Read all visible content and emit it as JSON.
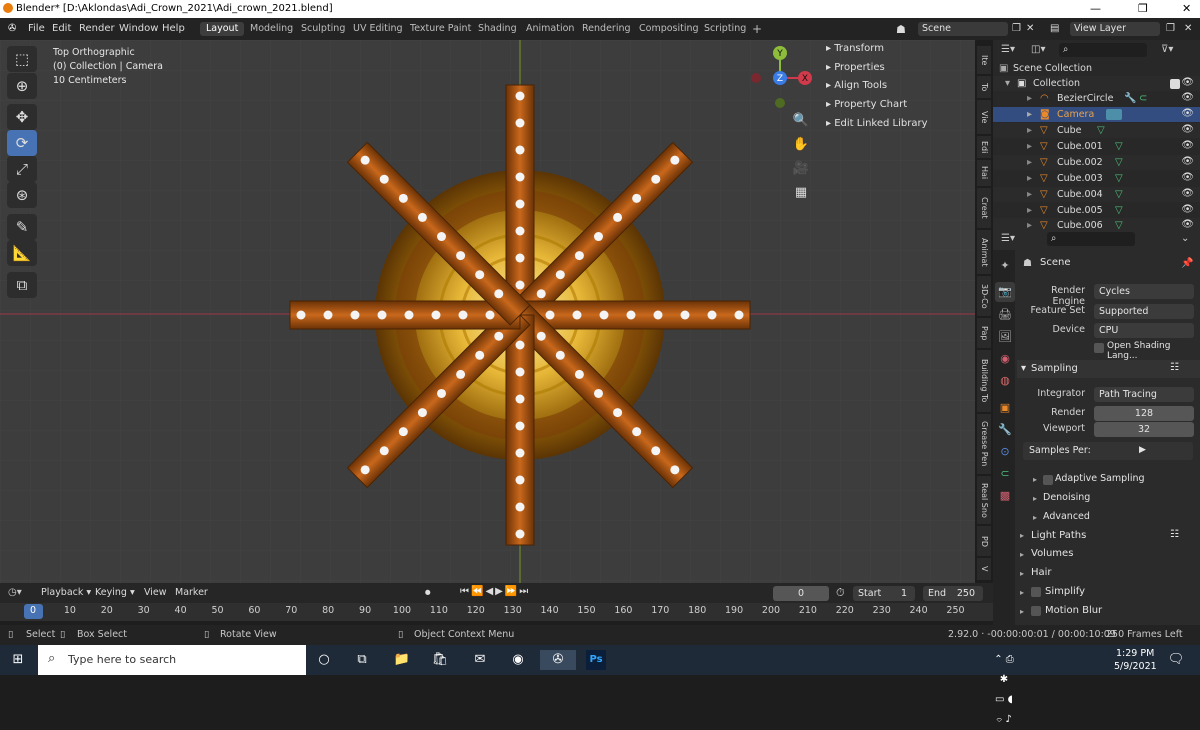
{
  "window": {
    "title": "Blender* [D:\\Aklondas\\Adi_Crown_2021\\Adi_crown_2021.blend]",
    "min": "—",
    "max": "❐",
    "close": "✕"
  },
  "menu": [
    "File",
    "Edit",
    "Render",
    "Window",
    "Help"
  ],
  "workspaces": [
    "Layout",
    "Modeling",
    "Sculpting",
    "UV Editing",
    "Texture Paint",
    "Shading",
    "Animation",
    "Rendering",
    "Compositing",
    "Scripting",
    "+"
  ],
  "scene_field": "Scene",
  "view_layer_field": "View Layer",
  "viewport": {
    "view_name": "Top Orthographic",
    "collection_info": "(0) Collection | Camera",
    "scale": "10 Centimeters",
    "gizmo": {
      "y": "Y",
      "x": "X",
      "z": "Z"
    },
    "side_panel": [
      "Transform",
      "Properties",
      "Align Tools",
      "Property Chart",
      "Edit Linked Library"
    ],
    "side_tabs": [
      "Ite",
      "To",
      "Vie",
      "Edi",
      "Hai",
      "Creat",
      "Animat",
      "3D-Co",
      "Pap",
      "Building To",
      "Grease Pen",
      "Real Sno",
      "PD",
      "V"
    ]
  },
  "outliner": {
    "root": "Scene Collection",
    "collection": "Collection",
    "items": [
      "BezierCircle",
      "Camera",
      "Cube",
      "Cube.001",
      "Cube.002",
      "Cube.003",
      "Cube.004",
      "Cube.005",
      "Cube.006"
    ]
  },
  "properties": {
    "context": "Scene",
    "render_engine": {
      "label": "Render Engine",
      "value": "Cycles"
    },
    "feature_set": {
      "label": "Feature Set",
      "value": "Supported"
    },
    "device": {
      "label": "Device",
      "value": "CPU"
    },
    "osl": "Open Shading Lang...",
    "sampling": "Sampling",
    "integrator": {
      "label": "Integrator",
      "value": "Path Tracing"
    },
    "render": {
      "label": "Render",
      "value": "128"
    },
    "viewport": {
      "label": "Viewport",
      "value": "32"
    },
    "samples_per": "Samples Per:",
    "adaptive": "Adaptive Sampling",
    "denoising": "Denoising",
    "advanced": "Advanced",
    "light_paths": "Light Paths",
    "volumes": "Volumes",
    "hair": "Hair",
    "simplify": "Simplify",
    "motion_blur": "Motion Blur"
  },
  "timeline": {
    "menus": [
      "Playback",
      "Keying",
      "View",
      "Marker"
    ],
    "current_frame": "0",
    "start_label": "Start",
    "start": "1",
    "end_label": "End",
    "end": "250",
    "ticks": [
      "0",
      "10",
      "20",
      "30",
      "40",
      "50",
      "60",
      "70",
      "80",
      "90",
      "100",
      "110",
      "120",
      "130",
      "140",
      "150",
      "160",
      "170",
      "180",
      "190",
      "200",
      "210",
      "220",
      "230",
      "240",
      "250"
    ]
  },
  "status": {
    "select": "Select",
    "box_select": "Box Select",
    "rotate": "Rotate View",
    "context_menu": "Object Context Menu",
    "info": "2.92.0 · -00:00:00:01 / 00:00:10:09",
    "frames_left": "250 Frames Left"
  },
  "taskbar": {
    "search_placeholder": "Type here to search",
    "time": "1:29 PM",
    "date": "5/9/2021"
  },
  "colors": {
    "accent": "#4772b3",
    "orange": "#e87d0d",
    "viewport_bg": "#3d3d3d",
    "x_axis": "#d03a4a",
    "y_axis": "#8dbd3a",
    "z_axis": "#3a7be6"
  }
}
